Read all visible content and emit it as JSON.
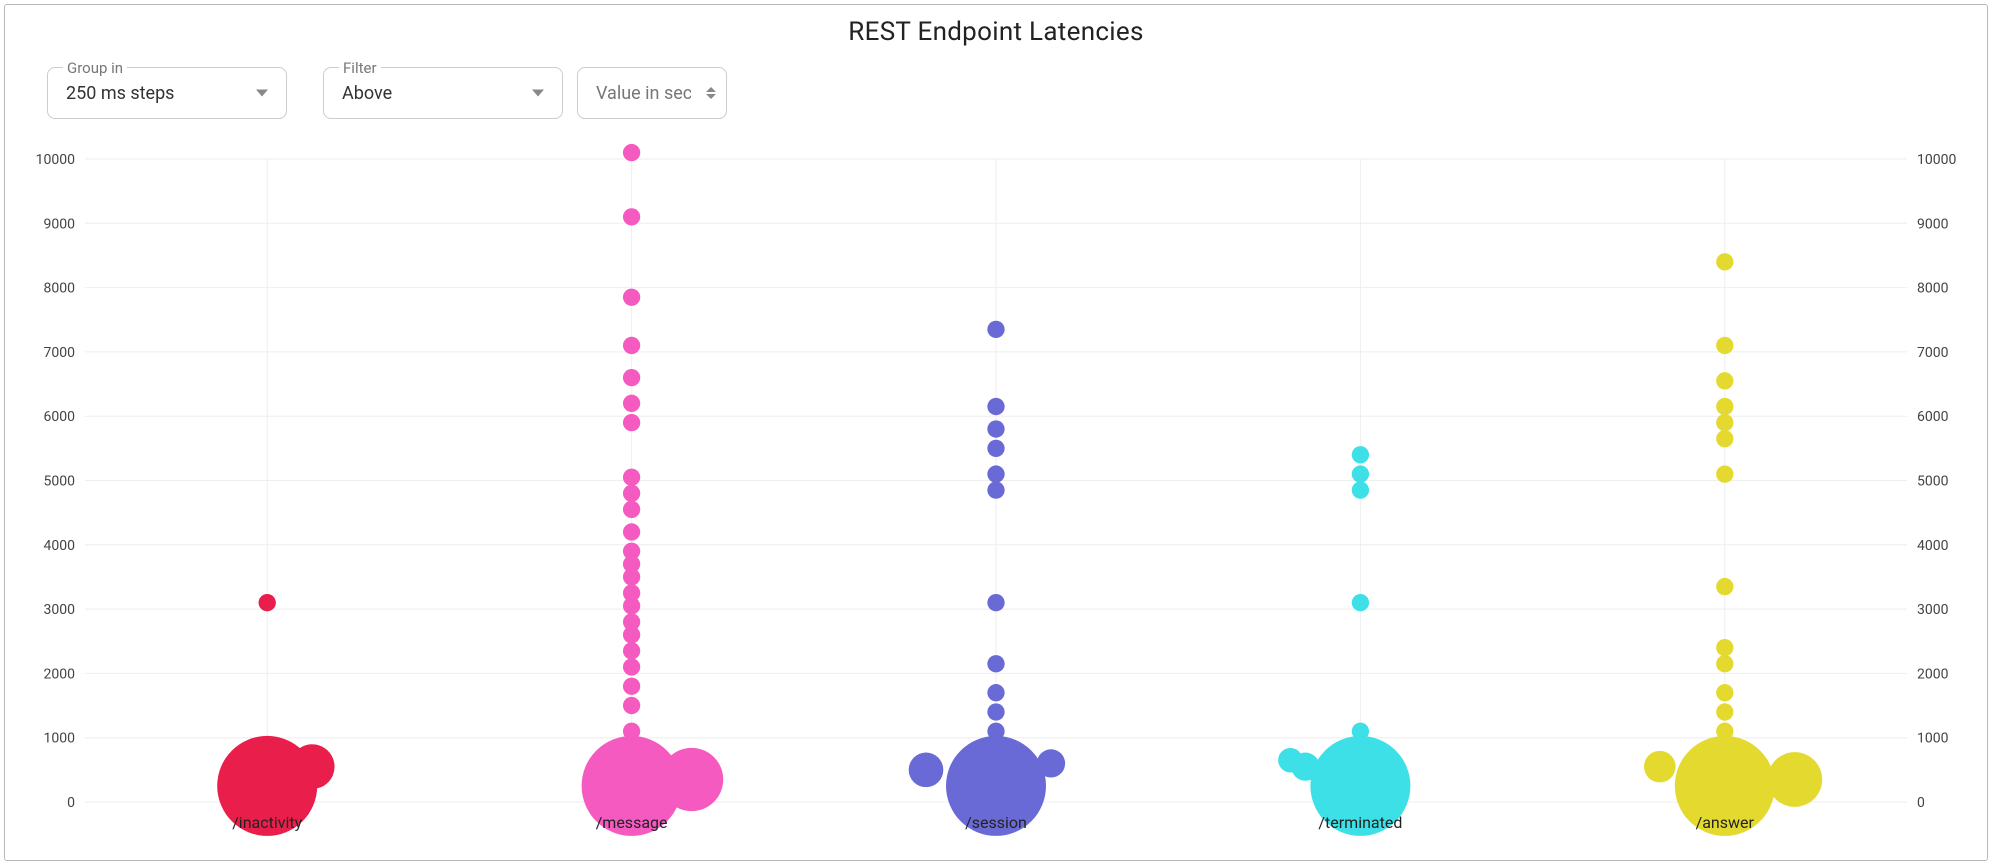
{
  "title": "REST Endpoint Latencies",
  "controls": {
    "group_in": {
      "label": "Group in",
      "value": "250 ms steps"
    },
    "filter": {
      "label": "Filter",
      "value": "Above"
    },
    "value": {
      "placeholder": "Value in seconds"
    }
  },
  "chart_data": {
    "type": "bubble",
    "xlabel": "",
    "ylabel": "",
    "ylim": [
      0,
      10000
    ],
    "yticks": [
      0,
      1000,
      2000,
      3000,
      4000,
      5000,
      6000,
      7000,
      8000,
      9000,
      10000
    ],
    "categories": [
      "/inactivity",
      "/message",
      "/session",
      "/terminated",
      "/answer"
    ],
    "colors": {
      "/inactivity": "#e91e4b",
      "/message": "#f55ac1",
      "/session": "#6a6ad6",
      "/terminated": "#3ee0e8",
      "/answer": "#e4da2f"
    },
    "series": [
      {
        "name": "/inactivity",
        "points": [
          {
            "y": 250,
            "size": 100
          },
          {
            "y": 500,
            "size": 10
          },
          {
            "y": 550,
            "size": 20
          },
          {
            "y": 3100,
            "size": 3
          }
        ]
      },
      {
        "name": "/message",
        "points": [
          {
            "y": 250,
            "size": 100
          },
          {
            "y": 350,
            "size": 40
          },
          {
            "y": 650,
            "size": 5
          },
          {
            "y": 1100,
            "size": 3
          },
          {
            "y": 1500,
            "size": 3
          },
          {
            "y": 1800,
            "size": 3
          },
          {
            "y": 2100,
            "size": 3
          },
          {
            "y": 2350,
            "size": 3
          },
          {
            "y": 2600,
            "size": 3
          },
          {
            "y": 2800,
            "size": 3
          },
          {
            "y": 3050,
            "size": 3
          },
          {
            "y": 3250,
            "size": 3
          },
          {
            "y": 3500,
            "size": 3
          },
          {
            "y": 3700,
            "size": 3
          },
          {
            "y": 3900,
            "size": 3
          },
          {
            "y": 4200,
            "size": 3
          },
          {
            "y": 4550,
            "size": 3
          },
          {
            "y": 4800,
            "size": 3
          },
          {
            "y": 5050,
            "size": 3
          },
          {
            "y": 5900,
            "size": 3
          },
          {
            "y": 6200,
            "size": 3
          },
          {
            "y": 6600,
            "size": 3
          },
          {
            "y": 7100,
            "size": 3
          },
          {
            "y": 7850,
            "size": 3
          },
          {
            "y": 9100,
            "size": 3
          },
          {
            "y": 10100,
            "size": 3
          }
        ]
      },
      {
        "name": "/session",
        "points": [
          {
            "y": 250,
            "size": 100
          },
          {
            "y": 500,
            "size": 12,
            "dx": -70
          },
          {
            "y": 600,
            "size": 8,
            "dx": 55
          },
          {
            "y": 900,
            "size": 3
          },
          {
            "y": 1100,
            "size": 3
          },
          {
            "y": 1400,
            "size": 3
          },
          {
            "y": 1700,
            "size": 3
          },
          {
            "y": 2150,
            "size": 3
          },
          {
            "y": 3100,
            "size": 3
          },
          {
            "y": 4850,
            "size": 3
          },
          {
            "y": 5100,
            "size": 3
          },
          {
            "y": 5500,
            "size": 3
          },
          {
            "y": 5800,
            "size": 3
          },
          {
            "y": 6150,
            "size": 3
          },
          {
            "y": 7350,
            "size": 3
          }
        ]
      },
      {
        "name": "/terminated",
        "points": [
          {
            "y": 250,
            "size": 100
          },
          {
            "y": 550,
            "size": 8,
            "dx": -55
          },
          {
            "y": 650,
            "size": 6,
            "dx": -70
          },
          {
            "y": 1100,
            "size": 3
          },
          {
            "y": 3100,
            "size": 3
          },
          {
            "y": 4850,
            "size": 3
          },
          {
            "y": 5100,
            "size": 3
          },
          {
            "y": 5400,
            "size": 3
          }
        ]
      },
      {
        "name": "/answer",
        "points": [
          {
            "y": 250,
            "size": 100
          },
          {
            "y": 350,
            "size": 30,
            "dx": 70
          },
          {
            "y": 550,
            "size": 10,
            "dx": -65
          },
          {
            "y": 1100,
            "size": 3
          },
          {
            "y": 1400,
            "size": 3
          },
          {
            "y": 1700,
            "size": 3
          },
          {
            "y": 2150,
            "size": 3
          },
          {
            "y": 2400,
            "size": 3
          },
          {
            "y": 3350,
            "size": 3
          },
          {
            "y": 5100,
            "size": 3
          },
          {
            "y": 5650,
            "size": 3
          },
          {
            "y": 5900,
            "size": 3
          },
          {
            "y": 6150,
            "size": 3
          },
          {
            "y": 6550,
            "size": 3
          },
          {
            "y": 7100,
            "size": 3
          },
          {
            "y": 8400,
            "size": 3
          }
        ]
      }
    ]
  }
}
